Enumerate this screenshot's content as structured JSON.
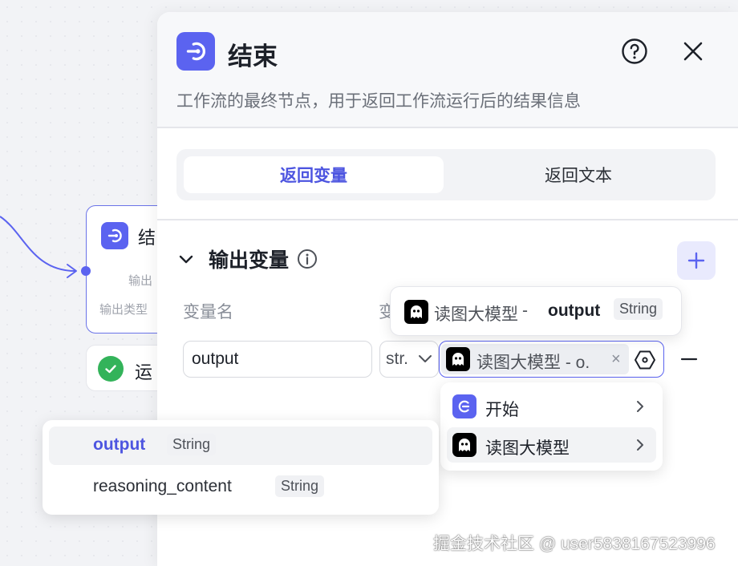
{
  "colors": {
    "accent": "#5b63f0",
    "success": "#33b35a",
    "panel_bg": "#ffffff",
    "canvas_bg": "#f2f3f6"
  },
  "canvas": {
    "end_node": {
      "icon": "end-node-icon",
      "title": "结",
      "output_label": "输出",
      "output_type_label": "输出类型"
    },
    "run_status": {
      "icon": "check-circle-icon",
      "text": "运"
    }
  },
  "panel": {
    "icon": "end-node-icon",
    "title": "结束",
    "description": "工作流的最终节点，用于返回工作流运行后的结果信息",
    "help_icon": "question-circle-icon",
    "close_icon": "close-icon",
    "tabs": [
      {
        "label": "返回变量",
        "active": true
      },
      {
        "label": "返回文本",
        "active": false
      }
    ],
    "section": {
      "title": "输出变量",
      "info_icon": "info-icon",
      "add_icon": "plus-icon"
    },
    "columns": {
      "name": "变量名",
      "value": "变"
    },
    "row": {
      "name_value": "output",
      "type_value": "str.",
      "reference_text": "读图大模型 - o.",
      "reference_clear": "×",
      "remove_icon": "minus-icon"
    }
  },
  "tooltip": {
    "node": "读图大模型",
    "separator": "-",
    "variable": "output",
    "type": "String"
  },
  "node_menu": {
    "items": [
      {
        "label": "开始",
        "icon": "start-node-icon"
      },
      {
        "label": "读图大模型",
        "icon": "ghost-llm-icon"
      }
    ]
  },
  "variable_menu": {
    "items": [
      {
        "name": "output",
        "type": "String"
      },
      {
        "name": "reasoning_content",
        "type": "String"
      }
    ]
  },
  "watermark": "掘金技术社区 @ user5838167523996"
}
